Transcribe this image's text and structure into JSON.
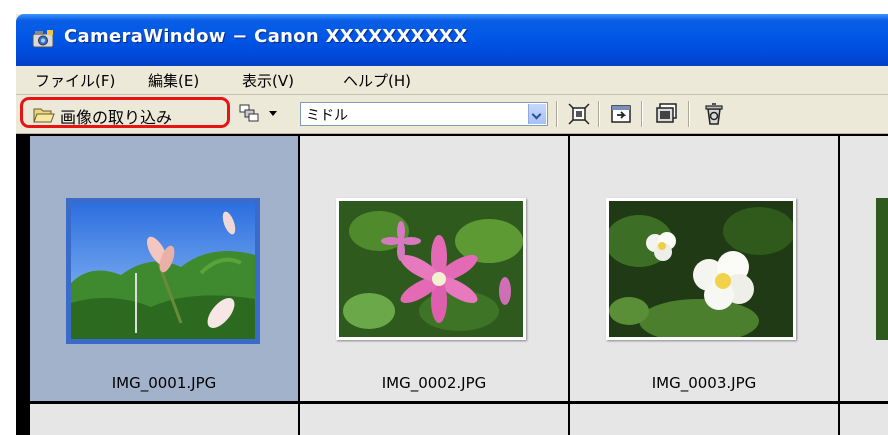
{
  "window": {
    "title": "CameraWindow − Canon XXXXXXXXXX"
  },
  "menu": {
    "items": [
      "ファイル(F)",
      "編集(E)",
      "表示(V)",
      "ヘルプ(H)"
    ]
  },
  "toolbar": {
    "import_label": "画像の取り込み",
    "thumbnail_size": "ミドル",
    "icons": [
      "layout-icon",
      "fit-icon",
      "export-icon",
      "slideshow-icon",
      "trash-icon"
    ]
  },
  "thumbnails": [
    {
      "filename": "IMG_0001.JPG",
      "selected": true
    },
    {
      "filename": "IMG_0002.JPG",
      "selected": false
    },
    {
      "filename": "IMG_0003.JPG",
      "selected": false
    }
  ],
  "colors": {
    "titlebar": "#0055e5",
    "selection": "#a2b2cb",
    "highlight_outline": "#e81313"
  }
}
